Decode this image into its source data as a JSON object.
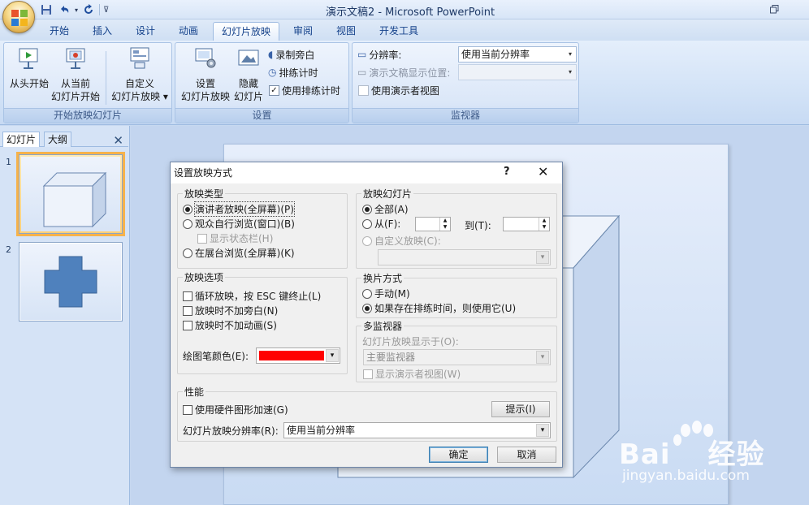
{
  "window": {
    "title": "演示文稿2 - Microsoft PowerPoint"
  },
  "tabs": [
    "开始",
    "插入",
    "设计",
    "动画",
    "幻灯片放映",
    "审阅",
    "视图",
    "开发工具"
  ],
  "ribbon": {
    "group_start": {
      "label": "开始放映幻灯片",
      "from_beginning": [
        "从头开始"
      ],
      "from_current": [
        "从当前",
        "幻灯片开始"
      ],
      "custom": [
        "自定义",
        "幻灯片放映 ▾"
      ]
    },
    "group_setup": {
      "label": "设置",
      "setup_show": [
        "设置",
        "幻灯片放映"
      ],
      "hide_slide": [
        "隐藏",
        "幻灯片"
      ],
      "record_narration": "录制旁白",
      "rehearse_timings": "排练计时",
      "use_rehearsed_timings": "使用排练计时",
      "use_rehearsed_checked": true
    },
    "group_monitors": {
      "label": "监视器",
      "resolution_label": "分辨率:",
      "resolution_value": "使用当前分辨率",
      "show_on_label": "演示文稿显示位置:",
      "presenter_view": "使用演示者视图"
    }
  },
  "slide_pane": {
    "tab_slides": "幻灯片",
    "tab_outline": "大纲",
    "slides": [
      {
        "number": "1",
        "shape": "cube",
        "selected": true
      },
      {
        "number": "2",
        "shape": "cross",
        "selected": false
      }
    ]
  },
  "dialog": {
    "title": "设置放映方式",
    "show_type": {
      "legend": "放映类型",
      "presenter": "演讲者放映(全屏幕)(P)",
      "browsed_window": "观众自行浏览(窗口)(B)",
      "show_scrollbar": "显示状态栏(H)",
      "kiosk": "在展台浏览(全屏幕)(K)",
      "selected": "presenter"
    },
    "show_options": {
      "legend": "放映选项",
      "loop": "循环放映，按 ESC 键终止(L)",
      "no_narration": "放映时不加旁白(N)",
      "no_animation": "放映时不加动画(S)",
      "pen_color_label": "绘图笔颜色(E):",
      "pen_color": "#ff0000"
    },
    "show_slides": {
      "legend": "放映幻灯片",
      "all": "全部(A)",
      "from": "从(F):",
      "to": "到(T):",
      "custom_show": "自定义放映(C):",
      "selected": "all"
    },
    "advance": {
      "legend": "换片方式",
      "manual": "手动(M)",
      "use_timings": "如果存在排练时间，则使用它(U)",
      "selected": "use_timings"
    },
    "multi_monitor": {
      "legend": "多监视器",
      "display_on_label": "幻灯片放映显示于(O):",
      "display_on_value": "主要监视器",
      "presenter_view": "显示演示者视图(W)"
    },
    "performance": {
      "legend": "性能",
      "hardware_accel": "使用硬件图形加速(G)",
      "tips_button": "提示(I)",
      "resolution_label": "幻灯片放映分辨率(R):",
      "resolution_value": "使用当前分辨率"
    },
    "ok": "确定",
    "cancel": "取消"
  },
  "watermark": {
    "brand": "Bai",
    "brand2": "经验",
    "url": "jingyan.baidu.com"
  }
}
